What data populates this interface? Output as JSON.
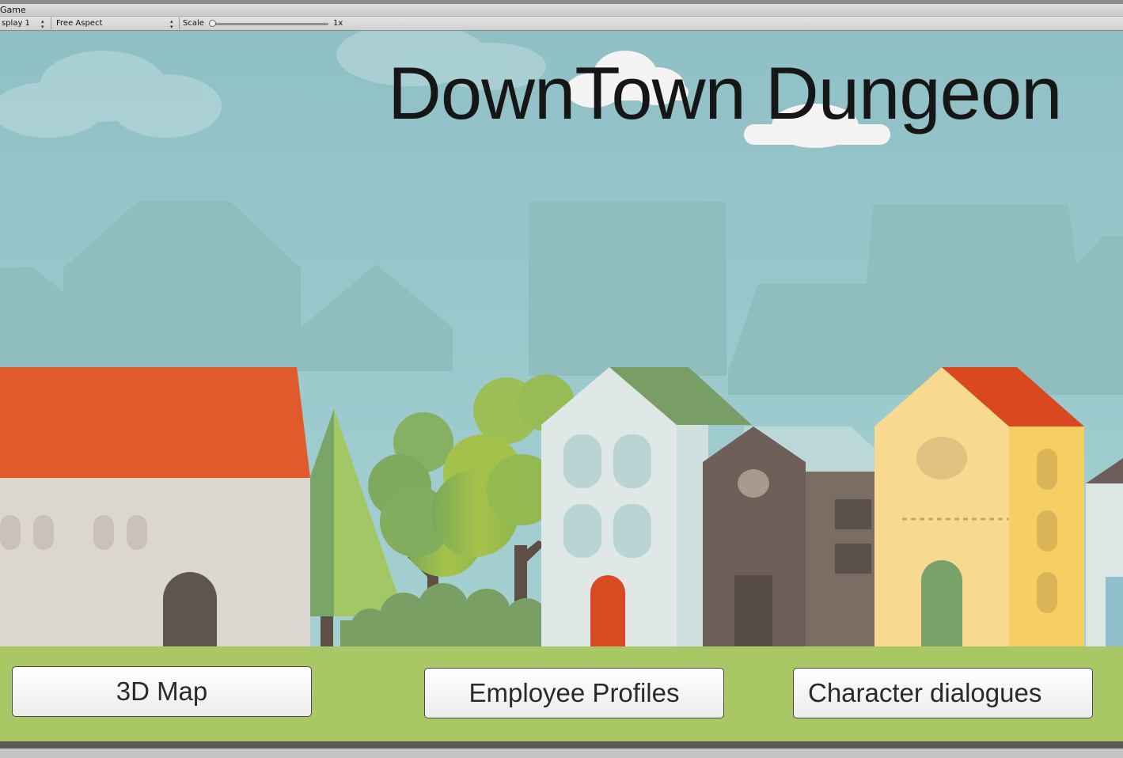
{
  "window": {
    "tab_title": "Game"
  },
  "toolbar": {
    "display_select": "splay 1",
    "aspect_select": "Free Aspect",
    "scale_label": "Scale",
    "scale_value": "1x"
  },
  "game": {
    "title": "DownTown Dungeon",
    "buttons": [
      {
        "label": "3D Map"
      },
      {
        "label": "Employee Profiles"
      },
      {
        "label": "Character dialogues"
      }
    ]
  },
  "colors": {
    "sky": "#9cc9cc",
    "ground": "#a9c765",
    "red_roof": "#e05a2c",
    "title_text": "#161616"
  }
}
